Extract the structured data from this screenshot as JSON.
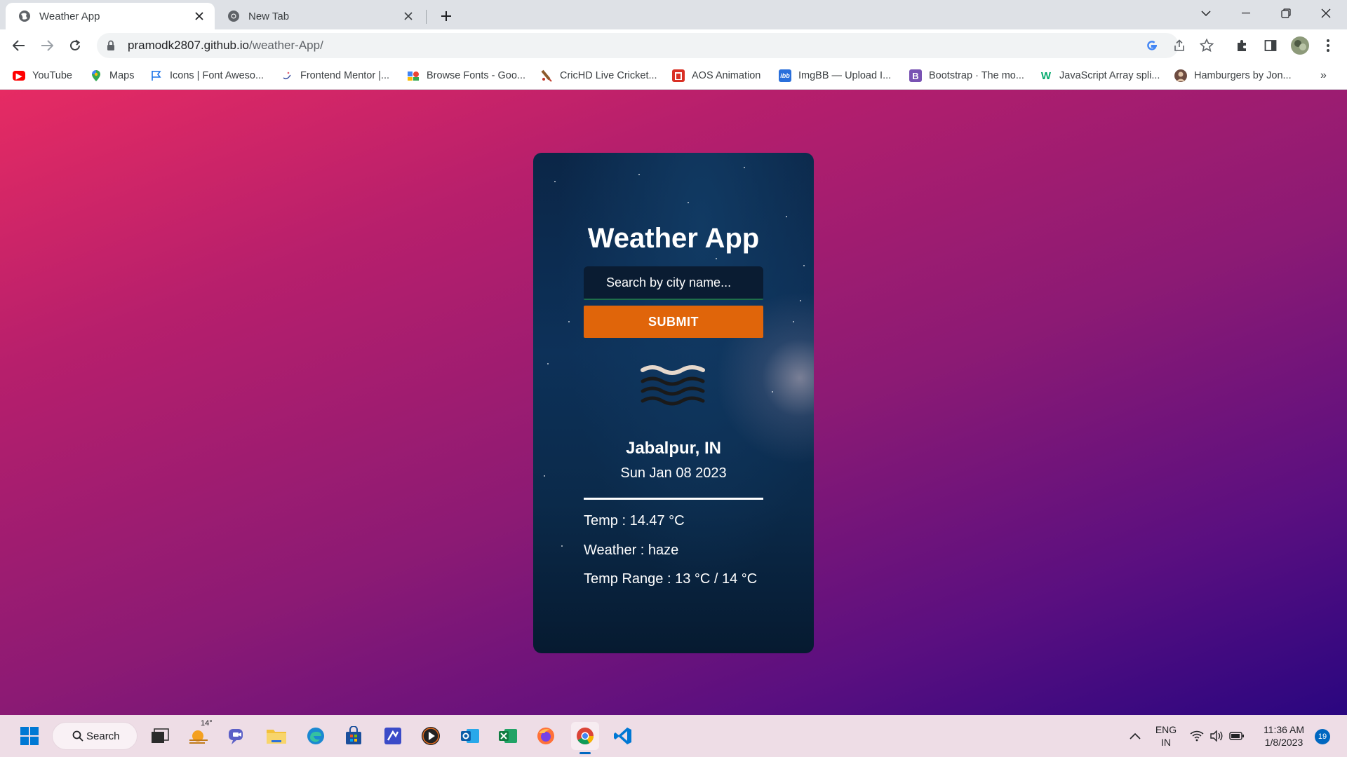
{
  "browser": {
    "tabs": [
      {
        "title": "Weather App",
        "active": true
      },
      {
        "title": "New Tab",
        "active": false
      }
    ],
    "url_host": "pramodk2807.github.io",
    "url_path": "/weather-App/",
    "bookmarks": [
      {
        "label": "YouTube",
        "icon": "youtube-icon",
        "color": "#ff0000"
      },
      {
        "label": "Maps",
        "icon": "maps-pin-icon",
        "color": "#34a853"
      },
      {
        "label": "Icons | Font Aweso...",
        "icon": "flag-icon",
        "color": "#1a73e8"
      },
      {
        "label": "Frontend Mentor |...",
        "icon": "frontend-mentor-icon",
        "color": "#3f54a3"
      },
      {
        "label": "Browse Fonts - Goo...",
        "icon": "google-fonts-icon",
        "color": "#4285f4"
      },
      {
        "label": "CricHD Live Cricket...",
        "icon": "cricket-bat-icon",
        "color": "#c0392b"
      },
      {
        "label": "AOS Animation",
        "icon": "aos-icon",
        "color": "#d93025"
      },
      {
        "label": "ImgBB — Upload I...",
        "icon": "imgbb-icon",
        "color": "#2a6fdb"
      },
      {
        "label": "Bootstrap · The mo...",
        "icon": "bootstrap-icon",
        "color": "#7952b3"
      },
      {
        "label": "JavaScript Array spli...",
        "icon": "w3schools-icon",
        "color": "#04aa6d"
      },
      {
        "label": "Hamburgers by Jon...",
        "icon": "avatar-icon",
        "color": "#6d4c41"
      }
    ]
  },
  "app": {
    "title": "Weather App",
    "search_placeholder": "Search by city name...",
    "submit_label": "SUBMIT",
    "weather_icon": "haze-icon",
    "city": "Jabalpur, IN",
    "date": "Sun Jan 08 2023",
    "temp": "Temp : 14.47 °C",
    "weather": "Weather : haze",
    "temp_range": "Temp Range : 13 °C / 14 °C"
  },
  "taskbar": {
    "search_label": "Search",
    "weather_badge": "14°",
    "language": "ENG",
    "region": "IN",
    "time": "11:36 AM",
    "date": "1/8/2023",
    "notifications": "19"
  },
  "colors": {
    "accent_orange": "#e0650a",
    "bg_gradient_start": "#e62b63",
    "bg_gradient_end": "#2a0680"
  }
}
